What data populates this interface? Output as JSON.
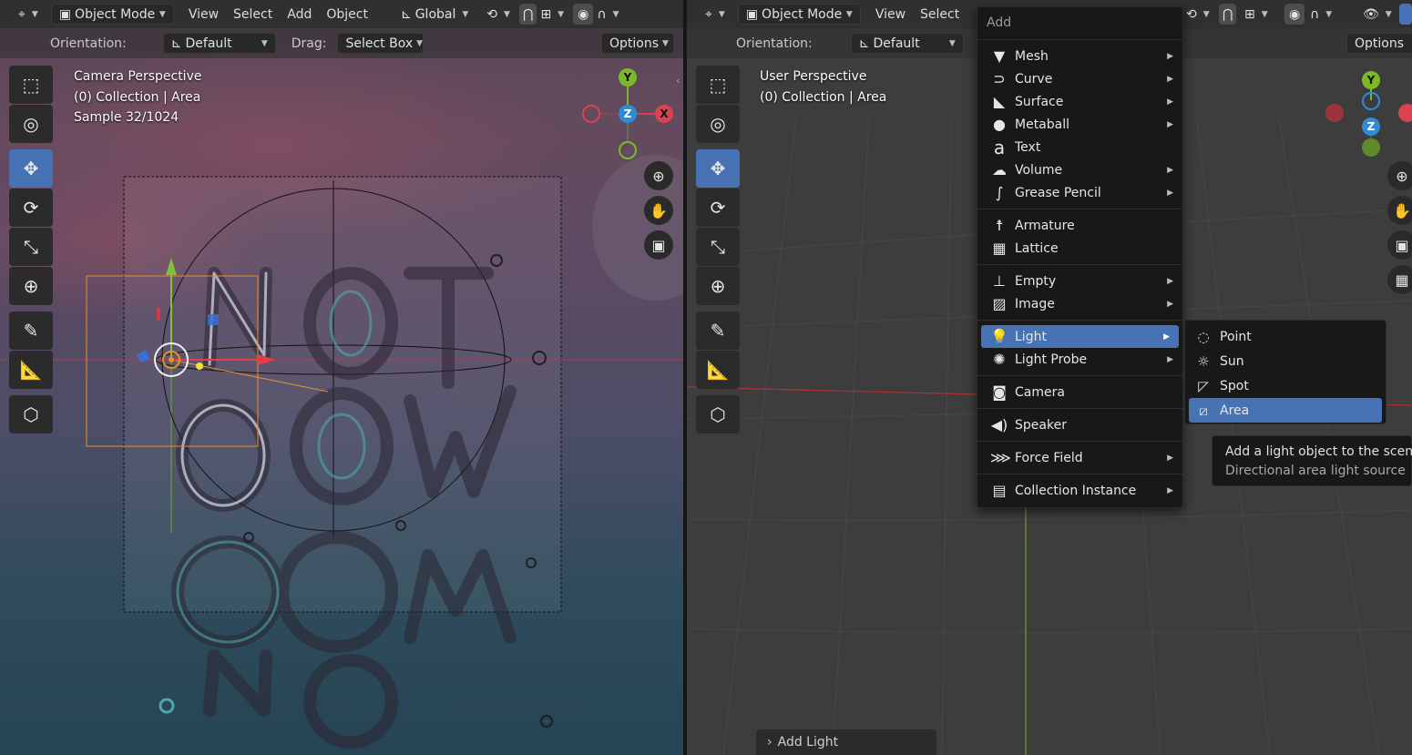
{
  "left_viewport": {
    "header": {
      "mode": "Object Mode",
      "menus": [
        "View",
        "Select",
        "Add",
        "Object"
      ],
      "transform_orientation": "Global"
    },
    "tool_header": {
      "orientation_label": "Orientation:",
      "orientation_value": "Default",
      "drag_label": "Drag:",
      "drag_value": "Select Box",
      "options_label": "Options"
    },
    "overlay": {
      "line1": "Camera Perspective",
      "line2": "(0) Collection | Area",
      "line3": "Sample 32/1024"
    },
    "gizmo": {
      "y": "Y",
      "z": "Z",
      "x": "X"
    }
  },
  "right_viewport": {
    "header": {
      "mode": "Object Mode",
      "menus": [
        "View",
        "Select"
      ]
    },
    "tool_header": {
      "orientation_label": "Orientation:",
      "orientation_value": "Default",
      "options_label": "Options"
    },
    "overlay": {
      "line1": "User Perspective",
      "line2": "(0) Collection | Area"
    },
    "gizmo": {
      "y": "Y",
      "z": "Z"
    }
  },
  "add_menu": {
    "title": "Add",
    "items": [
      {
        "label": "Mesh",
        "icon": "mesh-icon",
        "submenu": true
      },
      {
        "label": "Curve",
        "icon": "curve-icon",
        "submenu": true
      },
      {
        "label": "Surface",
        "icon": "surface-icon",
        "submenu": true
      },
      {
        "label": "Metaball",
        "icon": "metaball-icon",
        "submenu": true
      },
      {
        "label": "Text",
        "icon": "text-icon",
        "submenu": false
      },
      {
        "label": "Volume",
        "icon": "volume-icon",
        "submenu": true
      },
      {
        "label": "Grease Pencil",
        "icon": "grease-pencil-icon",
        "submenu": true
      },
      {
        "label": "Armature",
        "icon": "armature-icon",
        "submenu": false
      },
      {
        "label": "Lattice",
        "icon": "lattice-icon",
        "submenu": false
      },
      {
        "label": "Empty",
        "icon": "empty-icon",
        "submenu": true
      },
      {
        "label": "Image",
        "icon": "image-icon",
        "submenu": true
      },
      {
        "label": "Light",
        "icon": "light-icon",
        "submenu": true,
        "highlighted": true
      },
      {
        "label": "Light Probe",
        "icon": "light-probe-icon",
        "submenu": true
      },
      {
        "label": "Camera",
        "icon": "camera-icon",
        "submenu": false
      },
      {
        "label": "Speaker",
        "icon": "speaker-icon",
        "submenu": false
      },
      {
        "label": "Force Field",
        "icon": "force-field-icon",
        "submenu": true
      },
      {
        "label": "Collection Instance",
        "icon": "collection-instance-icon",
        "submenu": true
      }
    ]
  },
  "light_submenu": {
    "items": [
      {
        "label": "Point",
        "icon": "point-light-icon"
      },
      {
        "label": "Sun",
        "icon": "sun-light-icon"
      },
      {
        "label": "Spot",
        "icon": "spot-light-icon"
      },
      {
        "label": "Area",
        "icon": "area-light-icon",
        "highlighted": true
      }
    ]
  },
  "tooltip": {
    "line1": "Add a light object to the scene:",
    "line2": "Directional area light source"
  },
  "last_operator": {
    "label": "Add Light"
  },
  "colors": {
    "accent": "#4772b3",
    "axis_x": "#d9434f",
    "axis_y": "#7aba2a",
    "axis_z": "#2e8bd8",
    "menu_bg": "#181818"
  }
}
